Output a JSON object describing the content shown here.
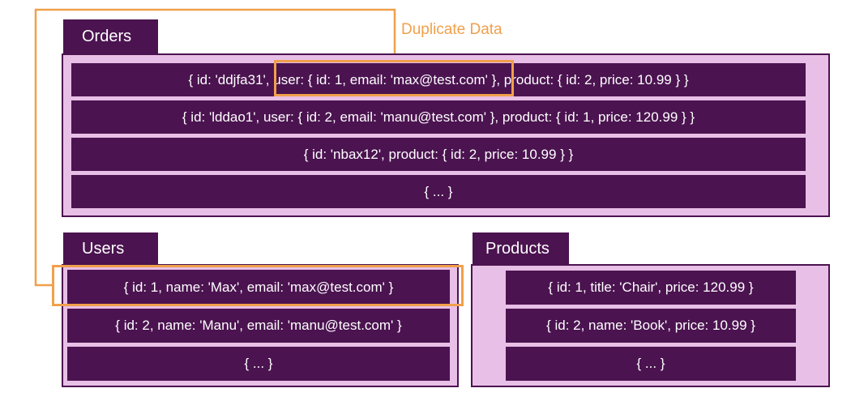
{
  "orders": {
    "title": "Orders",
    "rows": [
      "{ id: 'ddjfa31', user: { id: 1, email: 'max@test.com' }, product: { id: 2, price: 10.99 } }",
      "{ id: 'lddao1', user: { id: 2, email: 'manu@test.com' }, product: { id: 1, price: 120.99 } }",
      "{ id: 'nbax12', product: { id: 2, price: 10.99 } }",
      "{ ... }"
    ]
  },
  "users": {
    "title": "Users",
    "rows": [
      "{ id: 1, name: 'Max', email: 'max@test.com' }",
      "{ id: 2, name: 'Manu', email: 'manu@test.com' }",
      "{ ... }"
    ]
  },
  "products": {
    "title": "Products",
    "rows": [
      "{ id: 1, title: 'Chair', price: 120.99 }",
      "{ id: 2, name: 'Book', price: 10.99 }",
      "{ ... }"
    ]
  },
  "annotation": {
    "label": "Duplicate Data",
    "color": "#f0a04b"
  },
  "colors": {
    "dark": "#4b1350",
    "panel": "#e8bfe6"
  }
}
